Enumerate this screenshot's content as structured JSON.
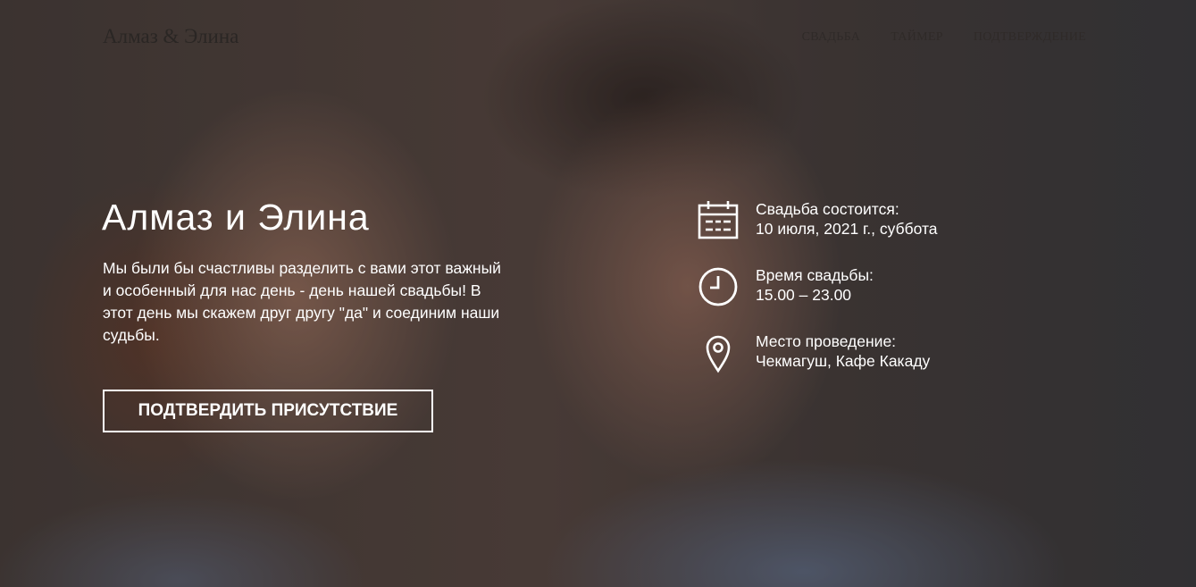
{
  "nav": {
    "brand": "Алмаз & Элина",
    "links": [
      "СВАДЬБА",
      "ТАЙМЕР",
      "ПОДТВЕРЖДЕНИЕ"
    ]
  },
  "hero": {
    "title": "Алмаз и Элина",
    "intro": "Мы были бы счастливы разделить с вами этот важный и особенный для нас день - день нашей свадьбы! В этот день мы скажем друг другу \"да\" и соединим наши судьбы.",
    "rsvp_button": "ПОДТВЕРДИТЬ ПРИСУТСТВИЕ"
  },
  "details": [
    {
      "icon": "calendar-icon",
      "label": "Свадьба состоится:",
      "value": "10 июля, 2021 г., суббота"
    },
    {
      "icon": "clock-icon",
      "label": "Время свадьбы:",
      "value": "15.00 – 23.00"
    },
    {
      "icon": "location-pin-icon",
      "label": "Место проведение:",
      "value": "Чекмагуш, Кафе Какаду"
    }
  ],
  "colors": {
    "text": "#ffffff",
    "nav_text": "#2f2a28"
  }
}
